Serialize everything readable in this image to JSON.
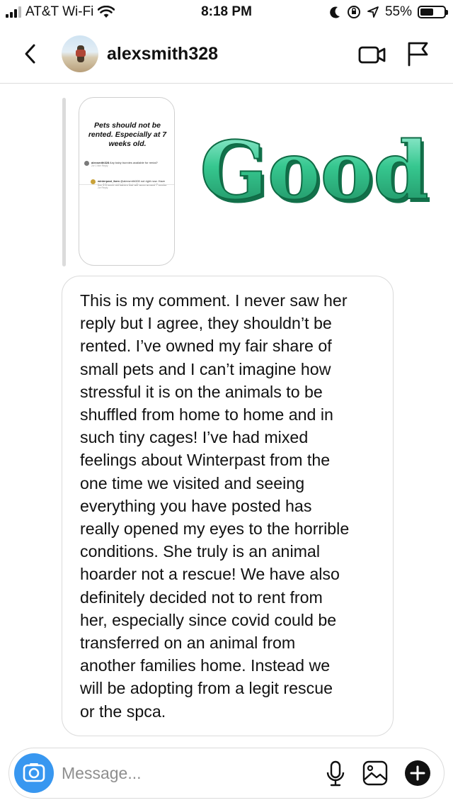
{
  "status_bar": {
    "carrier": "AT&T Wi-Fi",
    "time": "8:18 PM",
    "battery": "55%",
    "battery_level": 0.55
  },
  "header": {
    "username": "alexsmith328"
  },
  "shared_story": {
    "title": "Pets should not be rented. Especially at 7 weeks old.",
    "comment_1": {
      "author": "alexsmith328",
      "text": "Any baby bunnies available for rental?",
      "meta": "2w  1 like  Reply"
    },
    "comment_2": {
      "author": "winterpast_farm",
      "text": "@alexsmith328 not right now. Have five 2.5 week old babies that will wean around 7 weeks",
      "meta": "2w  Reply"
    }
  },
  "sticker": {
    "word": "Good"
  },
  "message": {
    "text": "This is my comment. I never saw her\nreply but I agree, they shouldn’t be\nrented. I’ve owned my fair share of\nsmall pets and I can’t imagine how\nstressful it is on the animals to be\nshuffled from home to home and in\nsuch tiny cages! I’ve had mixed\nfeelings about Winterpast from the\none time we visited and seeing\neverything you have posted has\nreally opened my eyes to the horrible\nconditions. She truly is an animal\nhoarder not a rescue! We have also\ndefinitely decided not to rent from\nher, especially since covid could be\ntransferred on an animal from\nanother families home. Instead we\nwill be adopting from a legit rescue\nor the spca."
  },
  "composer": {
    "placeholder": "Message..."
  },
  "colors": {
    "accent_blue": "#3897f0",
    "sticker_green": "#2fc48a",
    "border": "#dbdbdb"
  }
}
